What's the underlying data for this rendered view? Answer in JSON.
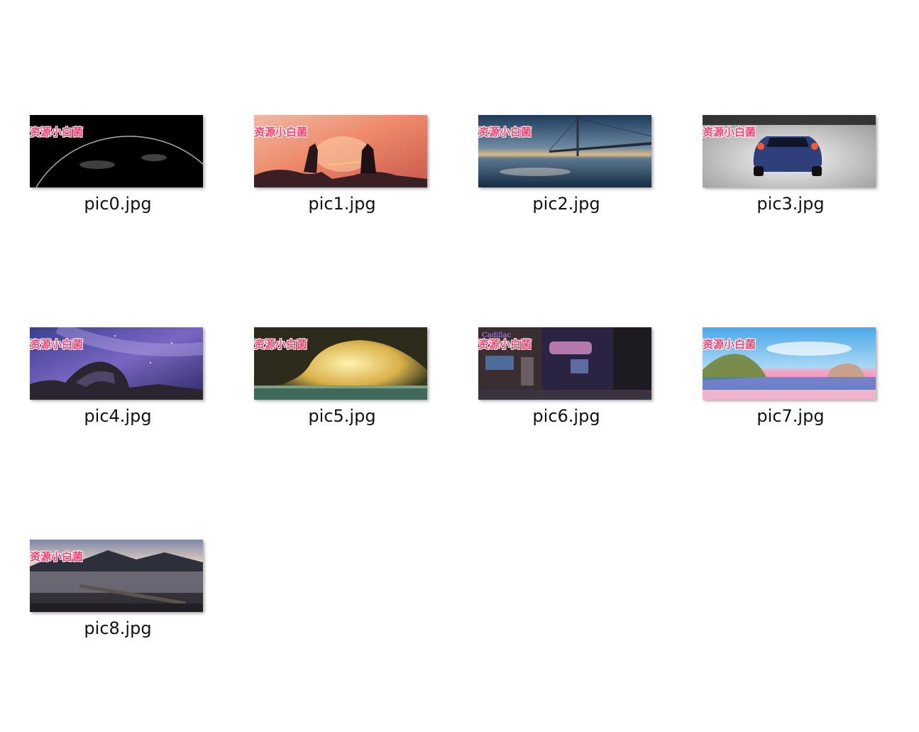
{
  "watermark": "资源小白菌",
  "files": [
    {
      "name": "pic0.jpg",
      "scene": "planet-horizon"
    },
    {
      "name": "pic1.jpg",
      "scene": "warriors-sunset"
    },
    {
      "name": "pic2.jpg",
      "scene": "bridge-sea"
    },
    {
      "name": "pic3.jpg",
      "scene": "sports-car"
    },
    {
      "name": "pic4.jpg",
      "scene": "milky-way-arch"
    },
    {
      "name": "pic5.jpg",
      "scene": "sea-cave"
    },
    {
      "name": "pic6.jpg",
      "scene": "neon-street"
    },
    {
      "name": "pic7.jpg",
      "scene": "pink-coast"
    },
    {
      "name": "pic8.jpg",
      "scene": "mountain-lake"
    }
  ],
  "colors": {
    "watermark": "#ff3d6e",
    "label": "#111111",
    "background": "#ffffff"
  }
}
